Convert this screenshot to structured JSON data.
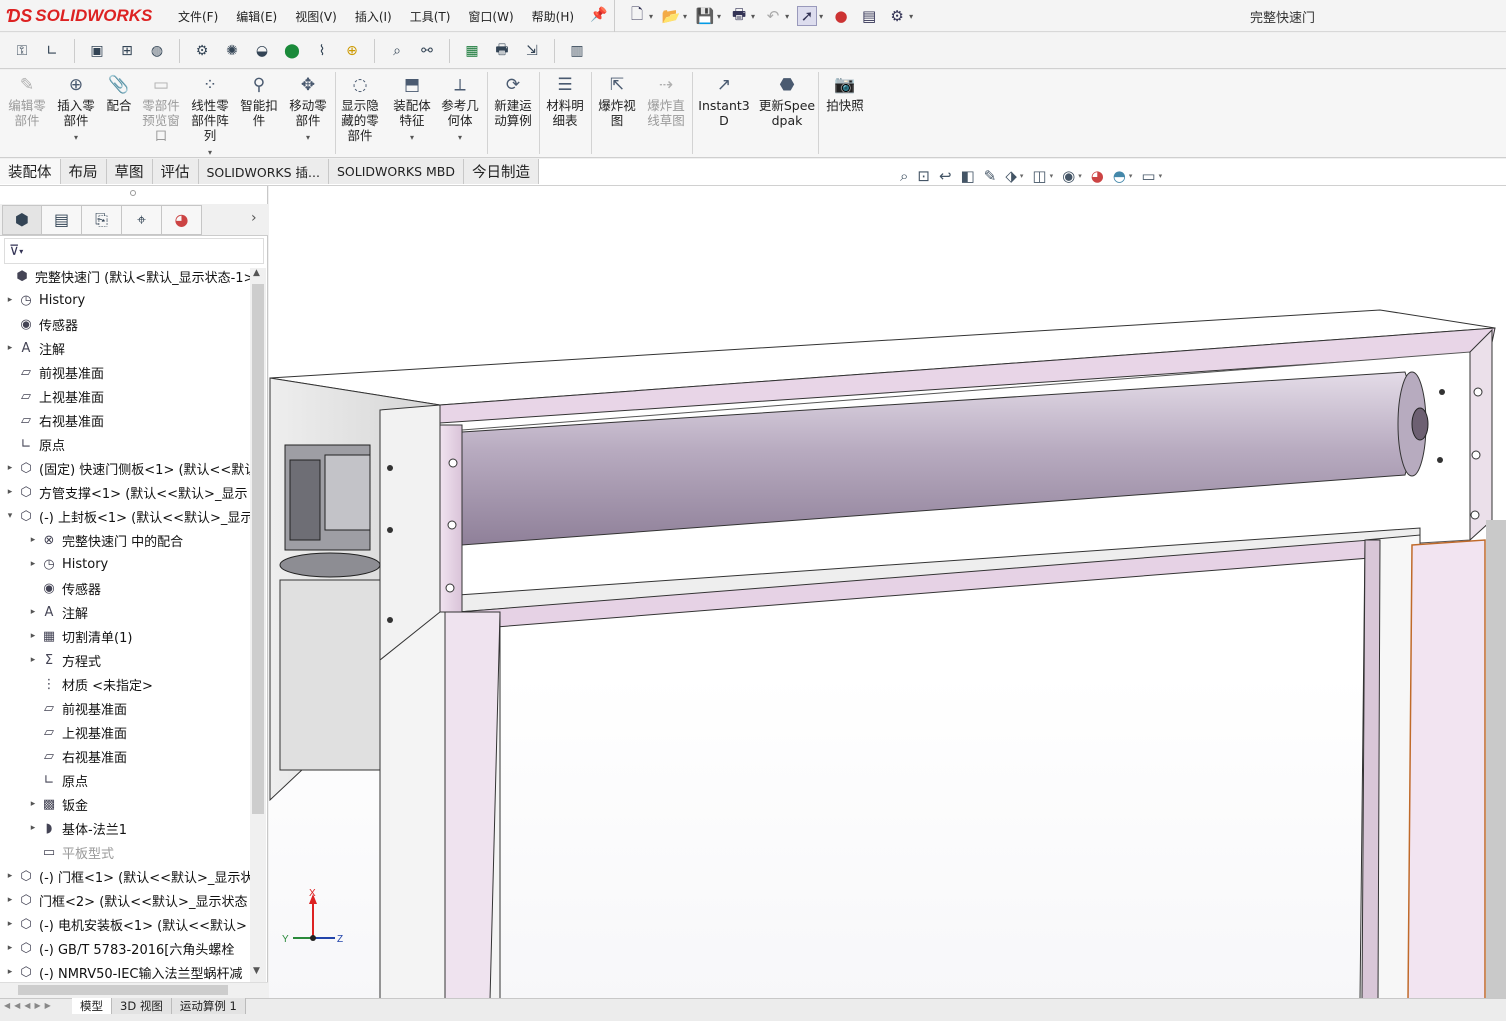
{
  "app": {
    "logo": "SOLIDWORKS",
    "doc_title": "完整快速门",
    "menus": [
      "文件(F)",
      "编辑(E)",
      "视图(V)",
      "插入(I)",
      "工具(T)",
      "窗口(W)",
      "帮助(H)"
    ]
  },
  "ribbon": [
    {
      "label": "编辑零部件",
      "icon": "edit-component-icon",
      "disabled": true
    },
    {
      "label": "插入零部件",
      "icon": "insert-component-icon",
      "disabled": false
    },
    {
      "label": "配合",
      "icon": "mate-icon",
      "disabled": false
    },
    {
      "label": "零部件预览窗口",
      "icon": "component-preview-icon",
      "disabled": true
    },
    {
      "label": "线性零部件阵列",
      "icon": "linear-pattern-icon",
      "disabled": false
    },
    {
      "label": "智能扣件",
      "icon": "smart-fasteners-icon",
      "disabled": false
    },
    {
      "label": "移动零部件",
      "icon": "move-component-icon",
      "disabled": false
    },
    {
      "label": "显示隐藏的零部件",
      "icon": "show-hidden-icon",
      "disabled": false
    },
    {
      "label": "装配体特征",
      "icon": "assembly-features-icon",
      "disabled": false
    },
    {
      "label": "参考几何体",
      "icon": "reference-geometry-icon",
      "disabled": false
    },
    {
      "label": "新建运动算例",
      "icon": "new-motion-study-icon",
      "disabled": false
    },
    {
      "label": "材料明细表",
      "icon": "bom-icon",
      "disabled": false
    },
    {
      "label": "爆炸视图",
      "icon": "exploded-view-icon",
      "disabled": false
    },
    {
      "label": "爆炸直线草图",
      "icon": "explode-line-sketch-icon",
      "disabled": true
    },
    {
      "label": "Instant3D",
      "icon": "instant3d-icon",
      "disabled": false
    },
    {
      "label": "更新Speedpak",
      "icon": "speedpak-icon",
      "disabled": false
    },
    {
      "label": "拍快照",
      "icon": "snapshot-icon",
      "disabled": false
    }
  ],
  "tabs": [
    "装配体",
    "布局",
    "草图",
    "评估",
    "SOLIDWORKS 插...",
    "SOLIDWORKS MBD",
    "今日制造"
  ],
  "tree": [
    {
      "label": "完整快速门 (默认<默认_显示状态-1>)",
      "level": 0,
      "exp": "",
      "icon": "assembly-icon",
      "dim": false
    },
    {
      "label": "History",
      "level": 1,
      "exp": "▸",
      "icon": "history-icon",
      "dim": false
    },
    {
      "label": "传感器",
      "level": 1,
      "exp": "",
      "icon": "sensor-icon",
      "dim": false
    },
    {
      "label": "注解",
      "level": 1,
      "exp": "▸",
      "icon": "annotation-icon",
      "dim": false
    },
    {
      "label": "前视基准面",
      "level": 1,
      "exp": "",
      "icon": "plane-icon",
      "dim": false
    },
    {
      "label": "上视基准面",
      "level": 1,
      "exp": "",
      "icon": "plane-icon",
      "dim": false
    },
    {
      "label": "右视基准面",
      "level": 1,
      "exp": "",
      "icon": "plane-icon",
      "dim": false
    },
    {
      "label": "原点",
      "level": 1,
      "exp": "",
      "icon": "origin-icon",
      "dim": false
    },
    {
      "label": "(固定) 快速门侧板<1> (默认<<默认",
      "level": 1,
      "exp": "▸",
      "icon": "part-icon",
      "dim": false
    },
    {
      "label": "方管支撑<1> (默认<<默认>_显示",
      "level": 1,
      "exp": "▸",
      "icon": "part-icon",
      "dim": false
    },
    {
      "label": "(-) 上封板<1> (默认<<默认>_显示",
      "level": 1,
      "exp": "▾",
      "icon": "part-icon",
      "dim": false
    },
    {
      "label": "完整快速门 中的配合",
      "level": 2,
      "exp": "▸",
      "icon": "mates-folder-icon",
      "dim": false
    },
    {
      "label": "History",
      "level": 2,
      "exp": "▸",
      "icon": "history-icon",
      "dim": false
    },
    {
      "label": "传感器",
      "level": 2,
      "exp": "",
      "icon": "sensor-icon",
      "dim": false
    },
    {
      "label": "注解",
      "level": 2,
      "exp": "▸",
      "icon": "annotation-icon",
      "dim": false
    },
    {
      "label": "切割清单(1)",
      "level": 2,
      "exp": "▸",
      "icon": "cut-list-icon",
      "dim": false
    },
    {
      "label": "方程式",
      "level": 2,
      "exp": "▸",
      "icon": "equations-icon",
      "dim": false
    },
    {
      "label": "材质 <未指定>",
      "level": 2,
      "exp": "",
      "icon": "material-icon",
      "dim": false
    },
    {
      "label": "前视基准面",
      "level": 2,
      "exp": "",
      "icon": "plane-icon",
      "dim": false
    },
    {
      "label": "上视基准面",
      "level": 2,
      "exp": "",
      "icon": "plane-icon",
      "dim": false
    },
    {
      "label": "右视基准面",
      "level": 2,
      "exp": "",
      "icon": "plane-icon",
      "dim": false
    },
    {
      "label": "原点",
      "level": 2,
      "exp": "",
      "icon": "origin-icon",
      "dim": false
    },
    {
      "label": "钣金",
      "level": 2,
      "exp": "▸",
      "icon": "sheet-metal-icon",
      "dim": false
    },
    {
      "label": "基体-法兰1",
      "level": 2,
      "exp": "▸",
      "icon": "base-flange-icon",
      "dim": false
    },
    {
      "label": "平板型式",
      "level": 2,
      "exp": "",
      "icon": "flat-pattern-icon",
      "dim": true
    },
    {
      "label": "(-) 门框<1> (默认<<默认>_显示状",
      "level": 1,
      "exp": "▸",
      "icon": "part-icon",
      "dim": false
    },
    {
      "label": "门框<2> (默认<<默认>_显示状态",
      "level": 1,
      "exp": "▸",
      "icon": "part-icon",
      "dim": false
    },
    {
      "label": "(-) 电机安装板<1> (默认<<默认>",
      "level": 1,
      "exp": "▸",
      "icon": "part-icon",
      "dim": false
    },
    {
      "label": "(-) GB/T 5783-2016[六角头螺栓",
      "level": 1,
      "exp": "▸",
      "icon": "part-icon",
      "dim": false
    },
    {
      "label": "(-) NMRV50-IEC输入法兰型蜗杆减",
      "level": 1,
      "exp": "▸",
      "icon": "part-icon",
      "dim": false
    }
  ],
  "bottom_tabs": [
    "模型",
    "3D 视图",
    "运动算例 1"
  ],
  "triad": {
    "x": "X",
    "y": "Y",
    "z": "Z"
  },
  "colors": {
    "frame_pink": "#e7d3e6",
    "roller": "#bfb3c6",
    "accent_red": "#d22222"
  }
}
